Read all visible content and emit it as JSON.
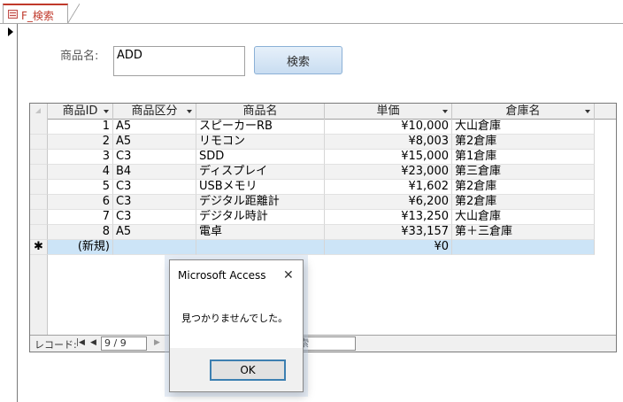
{
  "tab": {
    "title": "F_検索"
  },
  "form": {
    "product_label": "商品名:",
    "product_value": "ADD",
    "search_button": "検索"
  },
  "datasheet": {
    "columns": [
      "商品ID",
      "商品区分",
      "商品名",
      "単価",
      "倉庫名"
    ],
    "rows": [
      {
        "id": "1",
        "category": "A5",
        "name": "スピーカーRB",
        "price": "¥10,000",
        "warehouse": "大山倉庫"
      },
      {
        "id": "2",
        "category": "A5",
        "name": "リモコン",
        "price": "¥8,003",
        "warehouse": "第2倉庫"
      },
      {
        "id": "3",
        "category": "C3",
        "name": "SDD",
        "price": "¥15,000",
        "warehouse": "第1倉庫"
      },
      {
        "id": "4",
        "category": "B4",
        "name": "ディスプレイ",
        "price": "¥23,000",
        "warehouse": "第三倉庫"
      },
      {
        "id": "5",
        "category": "C3",
        "name": "USBメモリ",
        "price": "¥1,602",
        "warehouse": "第2倉庫"
      },
      {
        "id": "6",
        "category": "C3",
        "name": "デジタル距離計",
        "price": "¥6,200",
        "warehouse": "第2倉庫"
      },
      {
        "id": "7",
        "category": "C3",
        "name": "デジタル時計",
        "price": "¥13,250",
        "warehouse": "大山倉庫"
      },
      {
        "id": "8",
        "category": "A5",
        "name": "電卓",
        "price": "¥33,157",
        "warehouse": "第＋三倉庫"
      }
    ],
    "new_row": {
      "marker": "✱",
      "id": "(新規)",
      "price": "¥0"
    }
  },
  "navigation": {
    "label": "レコード:",
    "current": "9 / 9",
    "search_text": "索"
  },
  "dialog": {
    "title": "Microsoft Access",
    "message": "見つかりませんでした。",
    "ok": "OK"
  },
  "colors": {
    "tab_accent": "#c0392b",
    "new_row": "#cce4f7",
    "button": "#c9ddf1"
  }
}
